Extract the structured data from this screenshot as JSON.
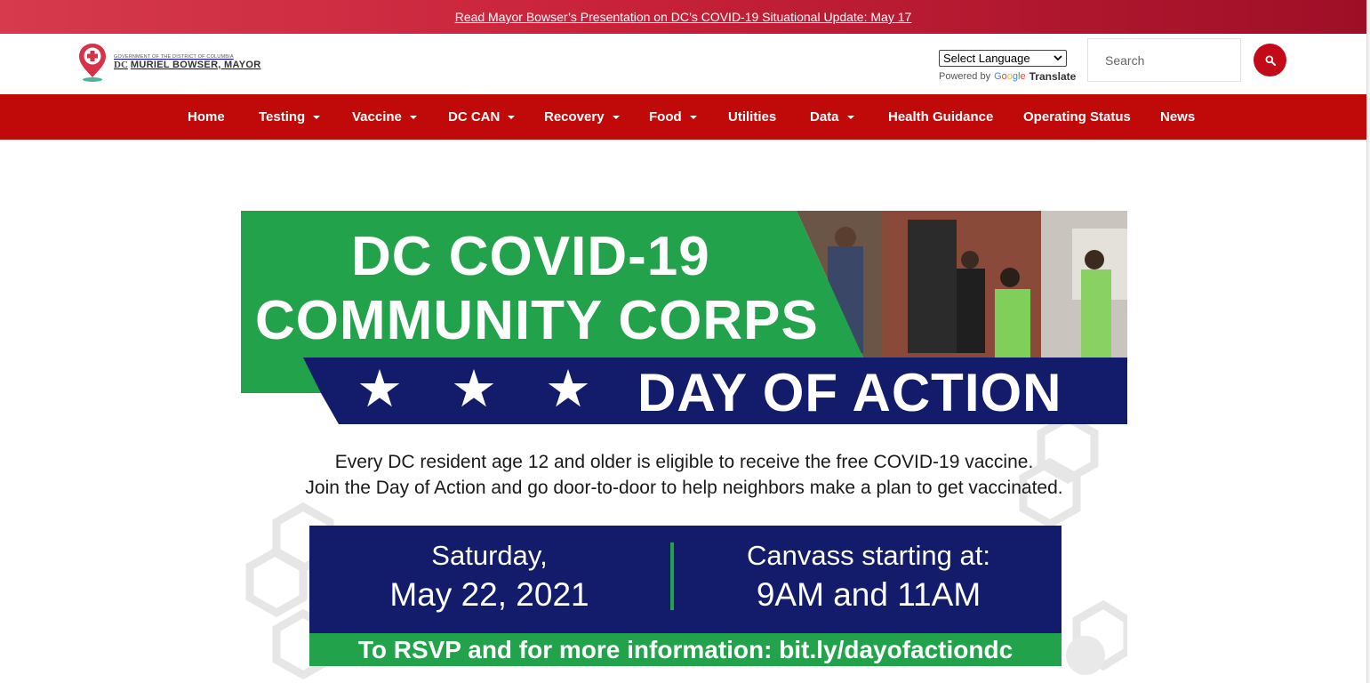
{
  "alert": {
    "text": "Read Mayor Bowser’s Presentation on DC’s COVID-19 Situational Update: May 17"
  },
  "logo": {
    "gov_line": "GOVERNMENT OF THE DISTRICT OF COLUMBIA",
    "dc": "DC",
    "name": "MURIEL BOWSER, MAYOR"
  },
  "language": {
    "select_label": "Select Language",
    "powered_by": "Powered by",
    "google": [
      "G",
      "o",
      "o",
      "g",
      "l",
      "e"
    ],
    "translate": "Translate"
  },
  "search": {
    "placeholder": "Search"
  },
  "nav": {
    "items": [
      {
        "label": "Home",
        "dropdown": false
      },
      {
        "label": "Testing",
        "dropdown": true
      },
      {
        "label": "Vaccine",
        "dropdown": true
      },
      {
        "label": "DC CAN",
        "dropdown": true
      },
      {
        "label": "Recovery",
        "dropdown": true
      },
      {
        "label": "Food",
        "dropdown": true
      },
      {
        "label": "Utilities",
        "dropdown": false
      },
      {
        "label": "Data",
        "dropdown": true
      },
      {
        "label": "Health Guidance",
        "dropdown": false
      },
      {
        "label": "Operating Status",
        "dropdown": false
      },
      {
        "label": "News",
        "dropdown": false
      }
    ]
  },
  "banner": {
    "headline_line1": "DC COVID-19",
    "headline_line2": "COMMUNITY CORPS",
    "stars": [
      "★",
      "★",
      "★"
    ],
    "subheadline": "DAY OF ACTION",
    "description_line1": "Every DC resident age 12 and older is eligible to receive the free COVID-19 vaccine.",
    "description_line2": "Join the Day of Action and go door-to-door to help neighbors make a plan to get vaccinated.",
    "date_line1": "Saturday,",
    "date_line2": "May 22, 2021",
    "time_line1": "Canvass starting at:",
    "time_line2": "9AM and 11AM",
    "rsvp": "To RSVP and for more information: bit.ly/dayofactiondc"
  },
  "colors": {
    "alert_bg": "#c8223a",
    "nav_bg": "#c00a0a",
    "search_btn": "#c20a18",
    "banner_green": "#22a34b",
    "banner_navy": "#121c6b"
  }
}
